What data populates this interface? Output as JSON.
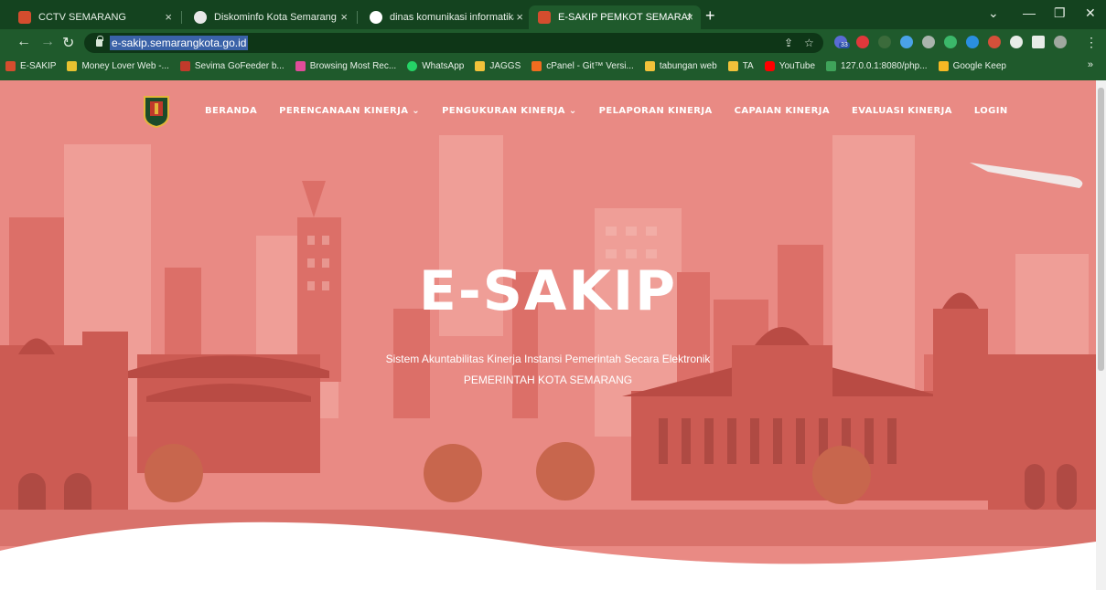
{
  "browser": {
    "tabs": [
      {
        "title": "CCTV SEMARANG",
        "favicon_color": "#d44d2e",
        "active": false
      },
      {
        "title": "Diskominfo Kota Semarang",
        "favicon_color": "#e8e8e8",
        "active": false
      },
      {
        "title": "dinas komunikasi informatika sta",
        "favicon_color": "#ffffff",
        "active": false
      },
      {
        "title": "E-SAKIP PEMKOT SEMARANG",
        "favicon_color": "#d44d2e",
        "active": true
      }
    ],
    "new_tab_icon": "plus-icon",
    "url": "e-sakip.semarangkota.go.id",
    "bookmarks": [
      {
        "label": "E-SAKIP",
        "color": "#d44d2e"
      },
      {
        "label": "Money Lover Web -...",
        "color": "#e8c230"
      },
      {
        "label": "Sevima GoFeeder b...",
        "color": "#c23a2b"
      },
      {
        "label": "Browsing Most Rec...",
        "color": "#e04d9a"
      },
      {
        "label": "WhatsApp",
        "color": "#25d366"
      },
      {
        "label": "JAGGS",
        "color": "#f2c23a"
      },
      {
        "label": "cPanel - Git™ Versi...",
        "color": "#f06c1f"
      },
      {
        "label": "tabungan web",
        "color": "#f2c23a"
      },
      {
        "label": "TA",
        "color": "#f2c23a"
      },
      {
        "label": "YouTube",
        "color": "#ff0000"
      },
      {
        "label": "127.0.0.1:8080/php...",
        "color": "#3fa35a"
      },
      {
        "label": "Google Keep",
        "color": "#f7b924"
      }
    ],
    "bookmarks_more": "»",
    "extension_badge": "33"
  },
  "site": {
    "nav": [
      {
        "label": "BERANDA",
        "dropdown": false
      },
      {
        "label": "PERENCANAAN KINERJA",
        "dropdown": true
      },
      {
        "label": "PENGUKURAN KINERJA",
        "dropdown": true
      },
      {
        "label": "PELAPORAN KINERJA",
        "dropdown": false
      },
      {
        "label": "CAPAIAN KINERJA",
        "dropdown": false
      },
      {
        "label": "EVALUASI KINERJA",
        "dropdown": false
      },
      {
        "label": "LOGIN",
        "dropdown": false
      }
    ],
    "hero": {
      "title": "E-SAKIP",
      "subtitle": "Sistem Akuntabilitas Kinerja Instansi Pemerintah Secara Elektronik",
      "subtitle2": "PEMERINTAH KOTA SEMARANG"
    },
    "colors": {
      "overlay": "#e98a84",
      "accent": "#c0392b"
    }
  }
}
